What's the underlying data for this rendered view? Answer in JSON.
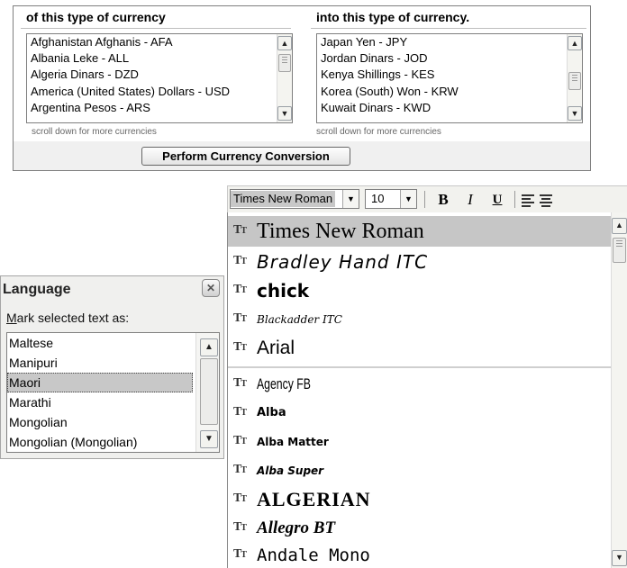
{
  "currency": {
    "from_header": "of this type of currency",
    "to_header": "into this type of currency.",
    "from_items": [
      "Afghanistan Afghanis - AFA",
      "Albania Leke - ALL",
      "Algeria Dinars - DZD",
      "America (United States) Dollars - USD",
      "Argentina Pesos - ARS"
    ],
    "to_items": [
      "Japan Yen - JPY",
      "Jordan Dinars - JOD",
      "Kenya Shillings - KES",
      "Korea (South) Won - KRW",
      "Kuwait Dinars - KWD"
    ],
    "scroll_note": "scroll down for more currencies",
    "perform_label": "Perform Currency Conversion"
  },
  "font_toolbar": {
    "font_name": "Times New Roman",
    "font_size": "10",
    "bold": "B",
    "italic": "I",
    "underline": "U"
  },
  "font_list": {
    "tt_glyph": "T",
    "recent_fonts": [
      "Times New Roman",
      "Bradley Hand ITC",
      "Chick",
      "Blackadder ITC",
      "Arial"
    ],
    "all_fonts": [
      "Agency FB",
      "Alba",
      "Alba Matter",
      "Alba Super",
      "ALGERIAN",
      "Allegro BT",
      "Andale Mono"
    ],
    "selected": "Times New Roman"
  },
  "language": {
    "title": "Language",
    "label_prefix": "M",
    "label_rest": "ark selected text as:",
    "items": [
      "Maltese",
      "Manipuri",
      "Maori",
      "Marathi",
      "Mongolian",
      "Mongolian (Mongolian)"
    ],
    "selected": "Maori"
  },
  "icons": {
    "close": "close-icon",
    "arrow_up": "arrow-up-icon",
    "arrow_down": "arrow-down-icon",
    "truetype": "truetype-icon",
    "align_left": "align-left-icon",
    "align_center": "align-center-icon"
  }
}
